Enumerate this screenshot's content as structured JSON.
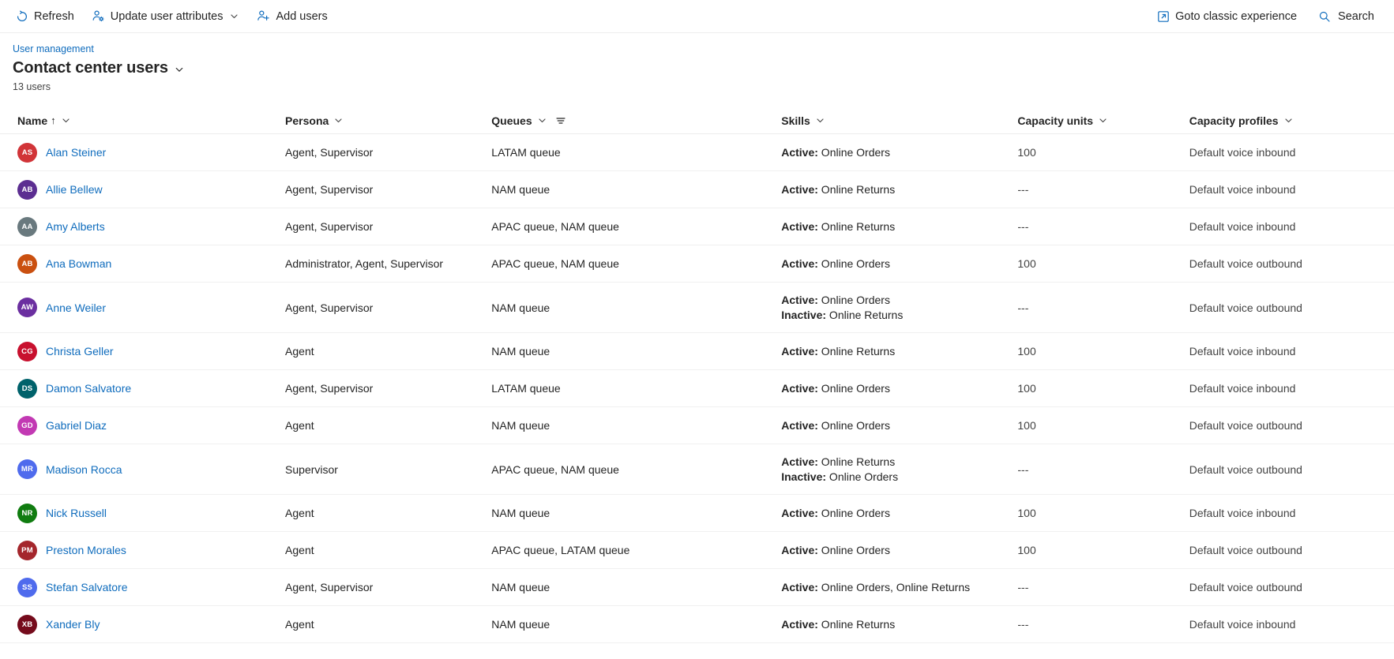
{
  "commandbar": {
    "refresh": {
      "label": "Refresh",
      "icon": "refresh-icon"
    },
    "update_attributes": {
      "label": "Update user attributes",
      "icon": "user-settings-icon"
    },
    "add_users": {
      "label": "Add users",
      "icon": "add-user-icon"
    },
    "goto_classic": {
      "label": "Goto classic experience",
      "icon": "open-external-icon"
    },
    "search": {
      "label": "Search",
      "icon": "search-icon"
    }
  },
  "header": {
    "breadcrumb": "User management",
    "title": "Contact center users",
    "count": "13 users"
  },
  "columns": [
    {
      "key": "name",
      "label": "Name",
      "sorted": "↑",
      "has_menu": true,
      "has_filter": false
    },
    {
      "key": "persona",
      "label": "Persona",
      "has_menu": true,
      "has_filter": false
    },
    {
      "key": "queues",
      "label": "Queues",
      "has_menu": true,
      "has_filter": true
    },
    {
      "key": "skills",
      "label": "Skills",
      "has_menu": true,
      "has_filter": false
    },
    {
      "key": "capacity_units",
      "label": "Capacity units",
      "has_menu": true,
      "has_filter": false
    },
    {
      "key": "capacity_profiles",
      "label": "Capacity profiles",
      "has_menu": true,
      "has_filter": false
    }
  ],
  "colors": {
    "link": "#0f6cbd",
    "text": "#242424",
    "border": "#f0f0f0"
  },
  "rows": [
    {
      "initials": "AS",
      "avatar_color": "#d13438",
      "name": "Alan Steiner",
      "persona": "Agent, Supervisor",
      "queues": "LATAM queue",
      "active": "Online Orders",
      "inactive": null,
      "capacity_units": "100",
      "capacity_profiles": "Default voice inbound"
    },
    {
      "initials": "AB",
      "avatar_color": "#5c2e91",
      "name": "Allie Bellew",
      "persona": "Agent, Supervisor",
      "queues": "NAM queue",
      "active": "Online Returns",
      "inactive": null,
      "capacity_units": "---",
      "capacity_profiles": "Default voice inbound"
    },
    {
      "initials": "AA",
      "avatar_color": "#69797e",
      "name": "Amy Alberts",
      "persona": "Agent, Supervisor",
      "queues": "APAC queue, NAM queue",
      "active": "Online Returns",
      "inactive": null,
      "capacity_units": "---",
      "capacity_profiles": "Default voice inbound"
    },
    {
      "initials": "AB",
      "avatar_color": "#ca5010",
      "name": "Ana Bowman",
      "persona": "Administrator, Agent, Supervisor",
      "queues": "APAC queue, NAM queue",
      "active": "Online Orders",
      "inactive": null,
      "capacity_units": "100",
      "capacity_profiles": "Default voice outbound"
    },
    {
      "initials": "AW",
      "avatar_color": "#6b2fa0",
      "name": "Anne Weiler",
      "persona": "Agent, Supervisor",
      "queues": "NAM queue",
      "active": "Online Orders",
      "inactive": "Online Returns",
      "capacity_units": "---",
      "capacity_profiles": "Default voice outbound"
    },
    {
      "initials": "CG",
      "avatar_color": "#c8102e",
      "name": "Christa Geller",
      "persona": "Agent",
      "queues": "NAM queue",
      "active": "Online Returns",
      "inactive": null,
      "capacity_units": "100",
      "capacity_profiles": "Default voice inbound"
    },
    {
      "initials": "DS",
      "avatar_color": "#00626b",
      "name": "Damon Salvatore",
      "persona": "Agent, Supervisor",
      "queues": "LATAM queue",
      "active": "Online Orders",
      "inactive": null,
      "capacity_units": "100",
      "capacity_profiles": "Default voice inbound"
    },
    {
      "initials": "GD",
      "avatar_color": "#c239b3",
      "name": "Gabriel Diaz",
      "persona": "Agent",
      "queues": "NAM queue",
      "active": "Online Orders",
      "inactive": null,
      "capacity_units": "100",
      "capacity_profiles": "Default voice outbound"
    },
    {
      "initials": "MR",
      "avatar_color": "#4f6bed",
      "name": "Madison Rocca",
      "persona": "Supervisor",
      "queues": "APAC queue, NAM queue",
      "active": "Online Returns",
      "inactive": "Online Orders",
      "capacity_units": "---",
      "capacity_profiles": "Default voice outbound"
    },
    {
      "initials": "NR",
      "avatar_color": "#107c10",
      "name": "Nick Russell",
      "persona": "Agent",
      "queues": "NAM queue",
      "active": "Online Orders",
      "inactive": null,
      "capacity_units": "100",
      "capacity_profiles": "Default voice inbound"
    },
    {
      "initials": "PM",
      "avatar_color": "#a4262c",
      "name": "Preston Morales",
      "persona": "Agent",
      "queues": "APAC queue, LATAM queue",
      "active": "Online Orders",
      "inactive": null,
      "capacity_units": "100",
      "capacity_profiles": "Default voice outbound"
    },
    {
      "initials": "SS",
      "avatar_color": "#4f6bed",
      "name": "Stefan Salvatore",
      "persona": "Agent, Supervisor",
      "queues": "NAM queue",
      "active": "Online Orders, Online Returns",
      "inactive": null,
      "capacity_units": "---",
      "capacity_profiles": "Default voice outbound"
    },
    {
      "initials": "XB",
      "avatar_color": "#750b1c",
      "name": "Xander Bly",
      "persona": "Agent",
      "queues": "NAM queue",
      "active": "Online Returns",
      "inactive": null,
      "capacity_units": "---",
      "capacity_profiles": "Default voice inbound"
    }
  ],
  "labels": {
    "active_prefix": "Active:",
    "inactive_prefix": "Inactive:"
  }
}
